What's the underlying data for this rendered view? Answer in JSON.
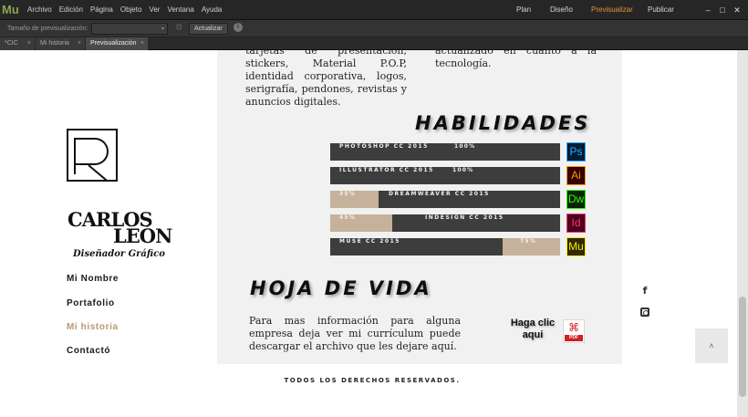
{
  "app": {
    "logo": "Mu",
    "menu": [
      "Archivo",
      "Edición",
      "Página",
      "Objeto",
      "Ver",
      "Ventana",
      "Ayuda"
    ],
    "modes": {
      "plan": "Plan",
      "design": "Diseño",
      "preview": "Previsualizar",
      "publish": "Publicar ▾"
    },
    "window_buttons": [
      "–",
      "□",
      "✕"
    ],
    "colors": {
      "active_mode": "#e49239",
      "brand": "#8aa64a"
    }
  },
  "toolbar": {
    "size_label": "Tamaño de previsualización:",
    "select_caret": "▾",
    "lock_icon": "⊡",
    "update_label": "Actualizar",
    "info_icon": "i"
  },
  "tabs": [
    {
      "label": "*CIC",
      "close": "×"
    },
    {
      "label": "Mi historia",
      "close": "×"
    },
    {
      "label": "Previsualización",
      "close": "×"
    }
  ],
  "page": {
    "intro_left": "tarjetas de presentación, stickers, Material P.O.P, identidad corporativa, logos, serigrafía, pendones, revistas y anuncios digitales.",
    "intro_right": "actualizado en cuanto a la tecnología.",
    "logo": {
      "name_1": "CARLOS",
      "name_2": "LEÓN",
      "tagline": "Diseñador Gráfico"
    },
    "nav": [
      {
        "label": "Mi Nombre",
        "active": false
      },
      {
        "label": "Portafolio",
        "active": false
      },
      {
        "label": "Mi historia",
        "active": true
      },
      {
        "label": "Contactó",
        "active": false
      }
    ],
    "skills_title": "HABILIDADES",
    "skills": [
      {
        "name": "PHOTOSHOP CC 2015",
        "percent_label": "100%",
        "level": 1.0,
        "icon": "Ps",
        "icon_color": "#31a8ff",
        "icon_bg": "#001e36"
      },
      {
        "name": "ILLUSTRATOR CC 2015",
        "percent_label": "100%",
        "level": 1.0,
        "icon": "Ai",
        "icon_color": "#ff9a00",
        "icon_bg": "#330000"
      },
      {
        "name": "DREAMWEAVER CC 2015",
        "percent_label": "35%",
        "level": 0.35,
        "icon": "Dw",
        "icon_color": "#35fa00",
        "icon_bg": "#072401"
      },
      {
        "name": "INDESIGN CC 2015",
        "percent_label": "45%",
        "level": 0.45,
        "icon": "Id",
        "icon_color": "#ff3366",
        "icon_bg": "#49021f"
      },
      {
        "name": "MUSE CC 2015",
        "percent_label": "75%",
        "level": 0.75,
        "icon": "Mu",
        "icon_color": "#ffe600",
        "icon_bg": "#2f2a00"
      }
    ],
    "cv_title": "HOJA DE VIDA",
    "cv_text": "Para mas información para alguna empresa deja ver mi currículum puede descargar el archivo que les dejare aquí.",
    "cv_link": "Haga clic aqui",
    "pdf_icon": {
      "symbol": "⌘",
      "tag": "PDF"
    },
    "social": {
      "facebook": "f"
    },
    "back_to_top": "˄",
    "footer": "TODOS LOS DERECHOS RESERVADOS."
  }
}
